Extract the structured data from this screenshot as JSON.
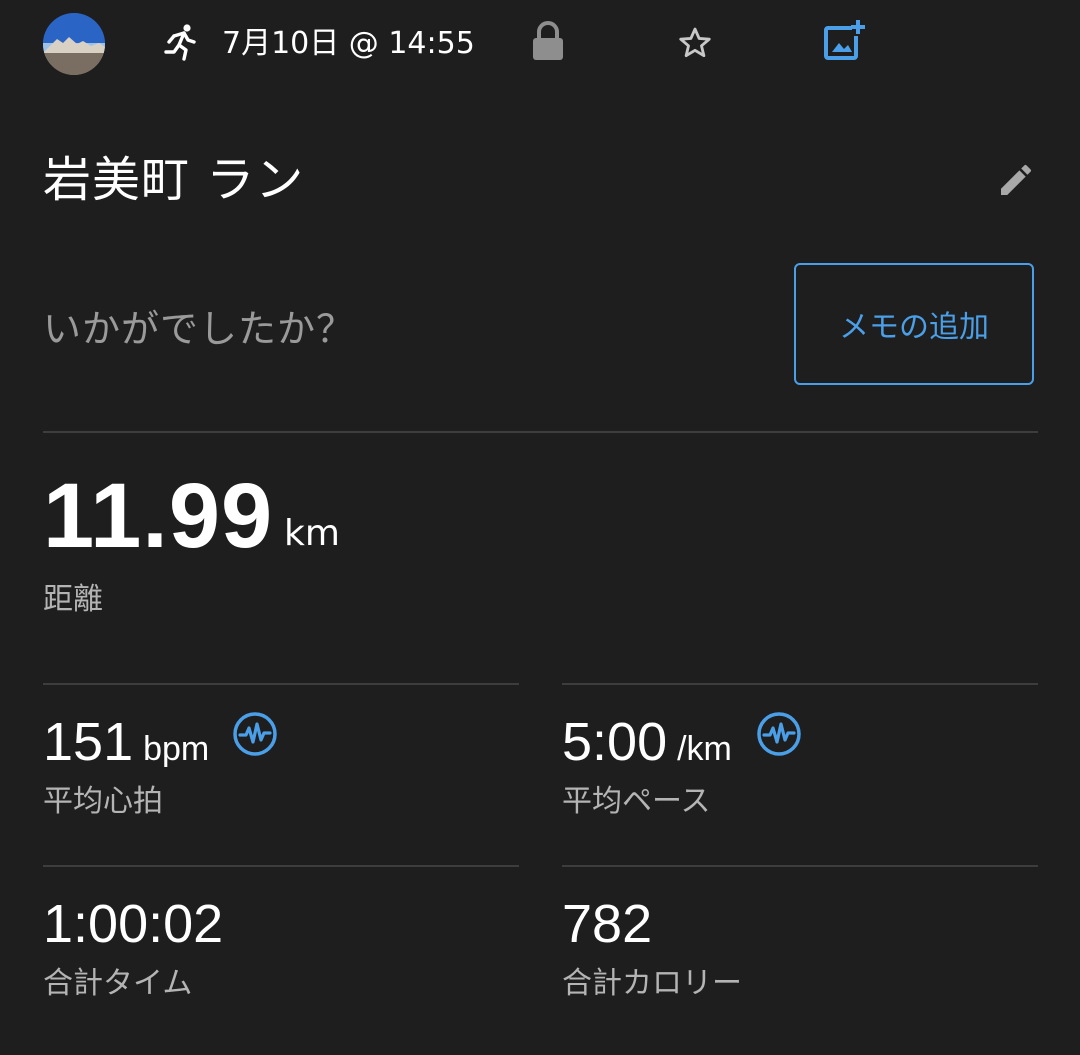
{
  "header": {
    "date": "7月10日 @ 14:55",
    "icons": {
      "activity": "running-icon",
      "privacy": "lock-icon",
      "favorite": "star-outline-icon",
      "add_photo": "add-photo-icon"
    }
  },
  "activity": {
    "title": "岩美町 ラン",
    "edit_icon": "pencil-icon"
  },
  "feedback": {
    "question": "いかがでしたか？",
    "memo_button": "メモの追加"
  },
  "distance": {
    "value": "11.99",
    "unit": "km",
    "label": "距離"
  },
  "stats": {
    "avg_hr": {
      "value": "151",
      "unit": "bpm",
      "label": "平均心拍",
      "badge": "heart-rate-wave-icon"
    },
    "avg_pace": {
      "value": "5:00",
      "unit": "/km",
      "label": "平均ペース",
      "badge": "heart-rate-wave-icon"
    },
    "total_time": {
      "value": "1:00:02",
      "label": "合計タイム"
    },
    "total_calories": {
      "value": "782",
      "label": "合計カロリー"
    }
  },
  "colors": {
    "background": "#1e1e1e",
    "accent": "#4a9fe8",
    "text_primary": "#ffffff",
    "text_secondary": "#b4b4b4",
    "divider": "#3d3d3d"
  }
}
